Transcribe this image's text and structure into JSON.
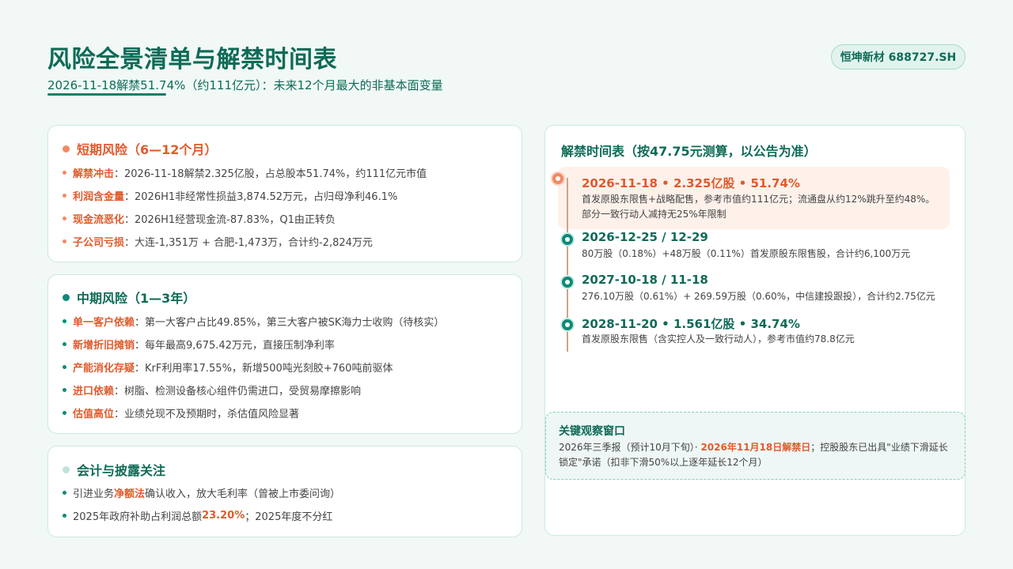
{
  "header": {
    "title": "风险全景清单与解禁时间表",
    "subtitle": "2026-11-18解禁51.74%（约111亿元）：未来12个月最大的非基本面变量",
    "ticker": "恒坤新材 688727.SH"
  },
  "short_term": {
    "title": "短期风险（6—12个月）",
    "items": [
      {
        "key": "解禁冲击",
        "text": "：2026-11-18解禁2.325亿股，占总股本51.74%，约111亿元市值"
      },
      {
        "key": "利润含金量",
        "text": "：2026H1非经常性损益3,874.52万元，占归母净利46.1%"
      },
      {
        "key": "现金流恶化",
        "text": "：2026H1经营现金流-87.83%，Q1由正转负"
      },
      {
        "key": "子公司亏损",
        "text": "：大连-1,351万 + 合肥-1,473万，合计约-2,824万元"
      }
    ]
  },
  "mid_term": {
    "title": "中期风险（1—3年）",
    "items": [
      {
        "key": "单一客户依赖",
        "text": "：第一大客户占比49.85%，第三大客户被SK海力士收购（待核实）"
      },
      {
        "key": "新增折旧摊销",
        "text": "：每年最高9,675.42万元，直接压制净利率"
      },
      {
        "key": "产能消化存疑",
        "text": "：KrF利用率17.55%，新增500吨光刻胶+760吨前驱体"
      },
      {
        "key": "进口依赖",
        "text": "：树脂、检测设备核心组件仍需进口，受贸易摩擦影响"
      },
      {
        "key": "估值高位",
        "text": "：业绩兑现不及预期时，杀估值风险显著"
      }
    ]
  },
  "accounting": {
    "title": "会计与披露关注",
    "item1": {
      "pre": "引进业务",
      "key": "净额法",
      "post": "确认收入，放大毛利率（曾被上市委问询）"
    },
    "item2": {
      "pre": "2025年政府补助占利润总额",
      "key": "23.20%",
      "post": "；2025年度不分红"
    }
  },
  "timeline": {
    "title": "解禁时间表（按47.75元测算，以公告为准）",
    "events": [
      {
        "head": "2026-11-18 • 2.325亿股 • 51.74%",
        "line1": "首发原股东限售+战略配售，参考市值约111亿元；流通盘从约12%跳升至约48%。",
        "line2": "部分一致行动人减持无25%年限制"
      },
      {
        "head": "2026-12-25 / 12-29",
        "line1": "80万股（0.18%）+48万股（0.11%）首发原股东限售股，合计约6,100万元"
      },
      {
        "head": "2027-10-18 / 11-18",
        "line1": "276.10万股（0.61%）+ 269.59万股（0.60%，中信建投跟投），合计约2.75亿元"
      },
      {
        "head": "2028-11-20 • 1.561亿股 • 34.74%",
        "line1": "首发原股东限售（含实控人及一致行动人），参考市值约78.8亿元"
      }
    ]
  },
  "watch": {
    "title": "关键观察窗口",
    "pre": "2026年三季报（预计10月下旬）· ",
    "key": "2026年11月18日解禁日",
    "post": "；控股股东已出具\"业绩下滑延长锁定\"承诺（扣非下滑50%以上逐年延长12个月）"
  },
  "colors": {
    "brand_teal": "#0e6b57",
    "accent_orange": "#e05a2b",
    "background": "#f1f8f6"
  }
}
